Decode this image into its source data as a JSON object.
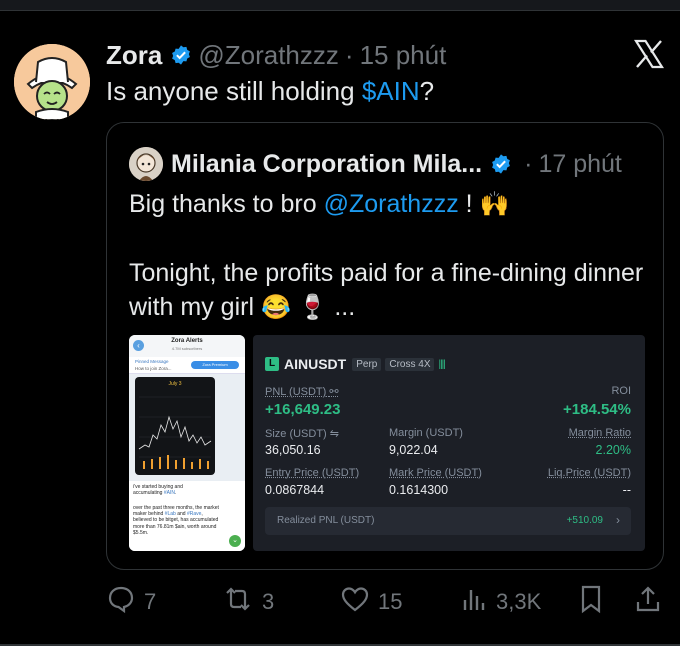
{
  "tweet": {
    "author_name": "Zora",
    "handle": "@Zorathzzz",
    "separator": "·",
    "time": "15 phút",
    "text_before": "Is anyone still holding ",
    "cashtag": "$AIN",
    "text_after": "?"
  },
  "quote": {
    "author_name": "Milania Corporation Mila...",
    "separator": "·",
    "time": "17 phút",
    "line1_before": "Big thanks to bro ",
    "line1_mention": "@Zorathzzz",
    "line1_after": " ! ",
    "line1_emoji": "🙌",
    "line2": "Tonight, the profits paid for a fine-dining dinner with my girl ",
    "line2_emoji": "😂 🍷",
    "line2_after": " ..."
  },
  "phone": {
    "title": "Zora Alerts",
    "subtitle": "4.7M subscribers",
    "pinned_label": "Pinned Message",
    "pinned_text": "How to join Zora...",
    "badge": "Zora Premium",
    "chart_date": "July 3",
    "msg1_before": "i've started buying and accumulating ",
    "msg1_tag": "#AIN",
    "msg1_after": ".",
    "msg2_before": "over the past three months, the market maker behind ",
    "msg2_tag1": "#Lab",
    "msg2_mid": " and ",
    "msg2_tag2": "#Rave",
    "msg2_after": ", believed to be bitget, has accumulated more than 76.81m $ain, worth around $5.5m."
  },
  "card": {
    "icon_letter": "L",
    "pair": "AINUSDT",
    "tag1": "Perp",
    "tag2": "Cross 4X",
    "bars": "||||",
    "pnl_label": "PNL (USDT)",
    "pnl_value": "+16,649.23",
    "roi_label": "ROI",
    "roi_value": "+184.54%",
    "size_label": "Size (USDT)",
    "size_value": "36,050.16",
    "margin_label": "Margin (USDT)",
    "margin_value": "9,022.04",
    "ratio_label": "Margin Ratio",
    "ratio_value": "2.20%",
    "entry_label": "Entry Price (USDT)",
    "entry_value": "0.0867844",
    "mark_label": "Mark Price (USDT)",
    "mark_value": "0.1614300",
    "liq_label": "Liq.Price (USDT)",
    "liq_value": "--",
    "realized_label": "Realized PNL (USDT)",
    "realized_value": "+510.09",
    "realized_chevron": "›"
  },
  "actions": {
    "replies": "7",
    "reposts": "3",
    "likes": "15",
    "views": "3,3K"
  },
  "colors": {
    "background": "#000000",
    "link": "#1d9bf0",
    "muted": "#71767b",
    "profit_green": "#2ebd85",
    "verified": "#1d9bf0"
  },
  "icons": [
    "verified-badge-icon",
    "x-logo-icon",
    "reply-icon",
    "repost-icon",
    "like-icon",
    "views-icon",
    "bookmark-icon",
    "share-icon"
  ]
}
